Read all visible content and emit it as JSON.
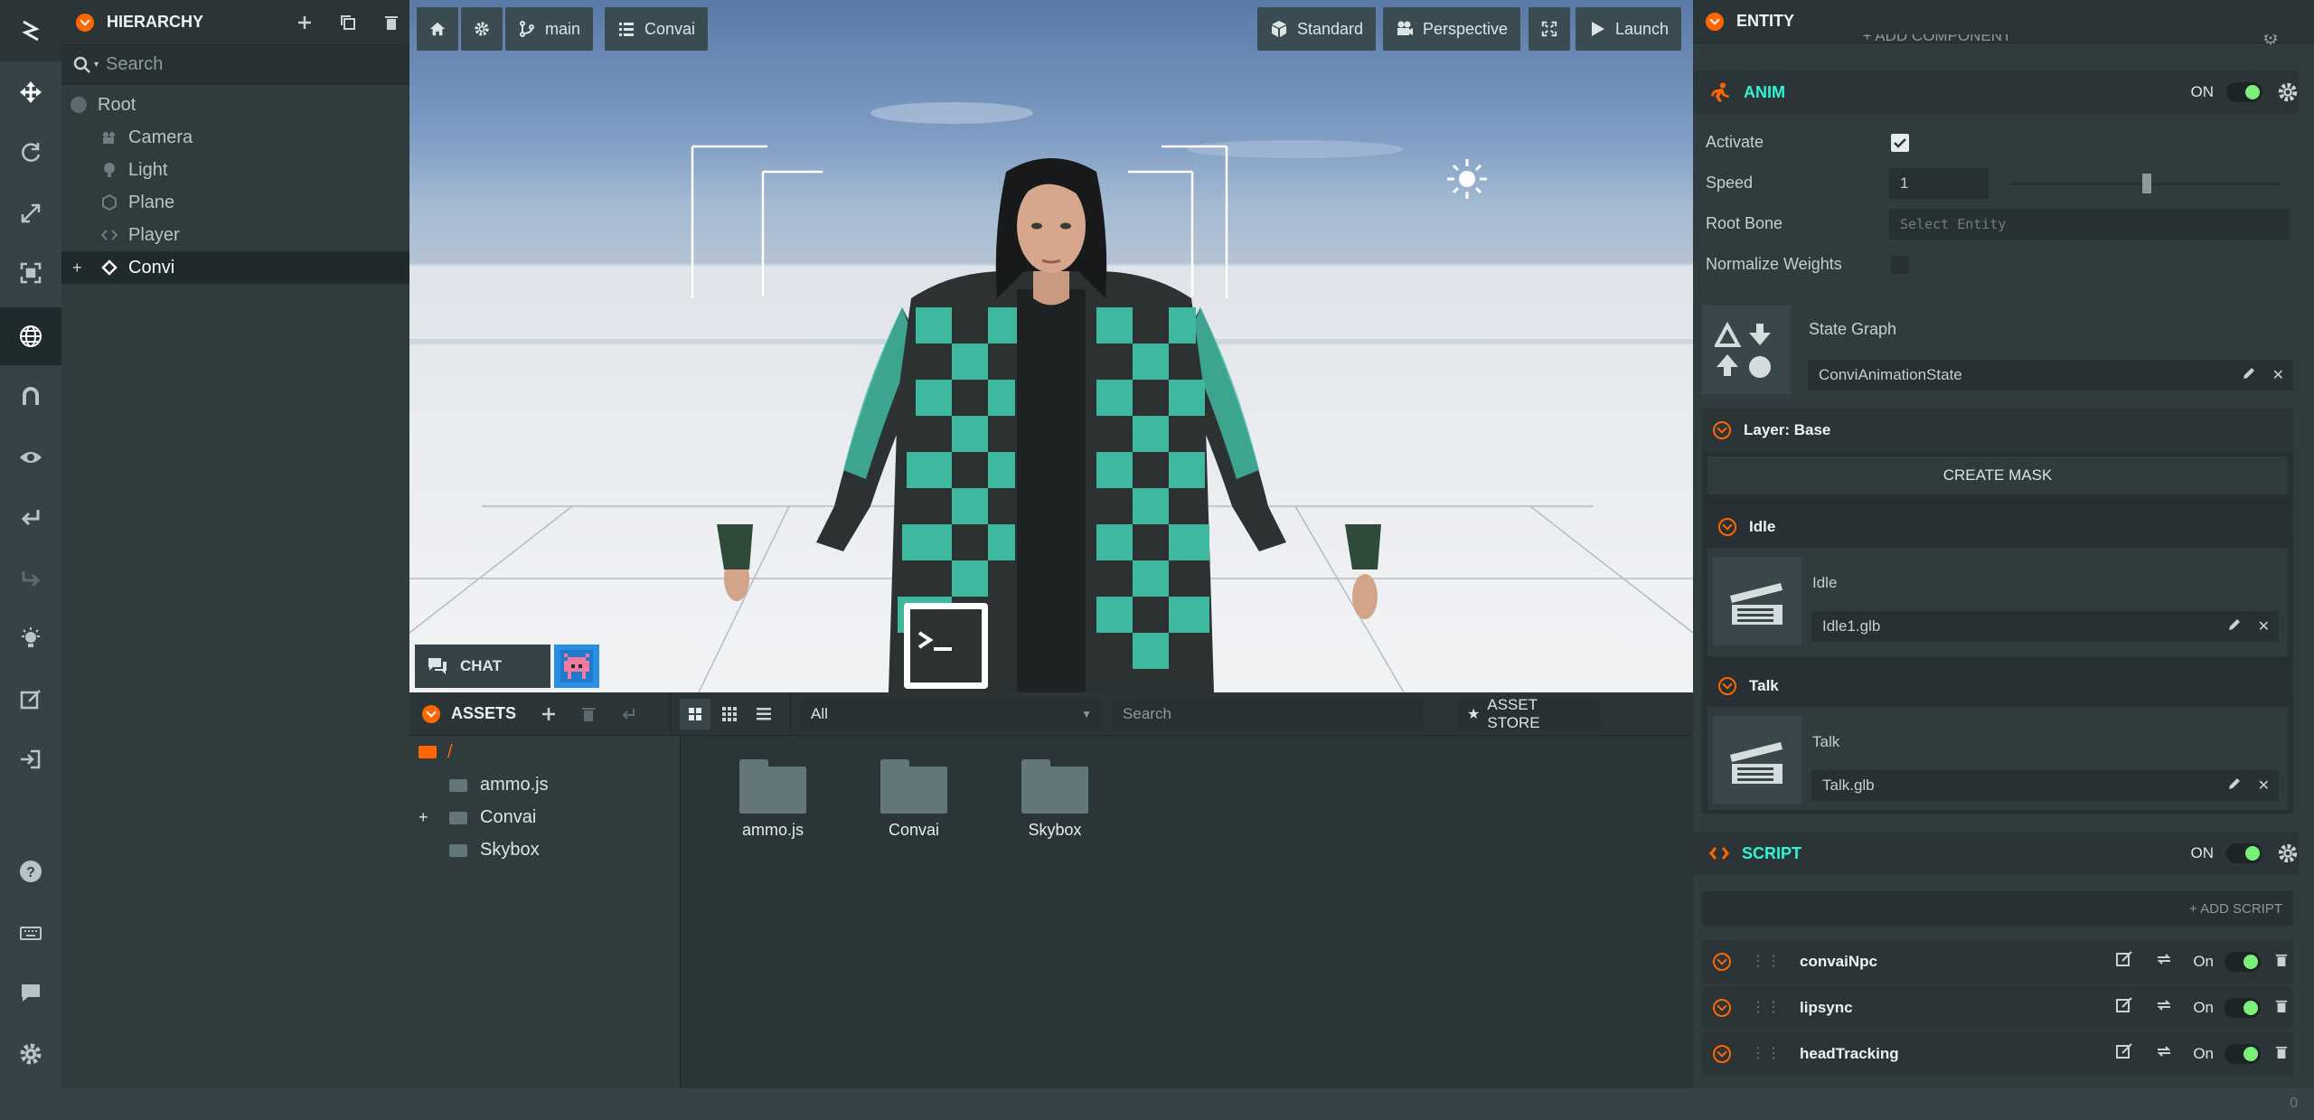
{
  "toolbar": {
    "tools": [
      "logo-icon",
      "move-icon",
      "rotate-icon",
      "scale-icon",
      "resize-icon",
      "world-icon",
      "magnet-icon",
      "eye-icon",
      "undo-icon",
      "redo-icon",
      "lightbulb-icon",
      "edit-icon",
      "publish-icon",
      "help-icon",
      "keyboard-icon",
      "chat-icon",
      "settings-icon"
    ]
  },
  "hierarchy": {
    "title": "HIERARCHY",
    "search_placeholder": "Search",
    "root": "Root",
    "items": [
      "Camera",
      "Light",
      "Plane",
      "Player",
      "Convi"
    ],
    "selected": "Convi"
  },
  "viewport": {
    "branch": "main",
    "project": "Convai",
    "render_mode": "Standard",
    "camera": "Perspective",
    "launch": "Launch",
    "chat_label": "CHAT"
  },
  "assets": {
    "title": "ASSETS",
    "filter": "All",
    "search_placeholder": "Search",
    "store": "ASSET STORE",
    "root_path": "/",
    "tree": [
      "ammo.js",
      "Convai",
      "Skybox"
    ],
    "folders": [
      "ammo.js",
      "Convai",
      "Skybox"
    ]
  },
  "inspector": {
    "title": "ENTITY",
    "add_component": "ADD COMPONENT",
    "anim": {
      "title": "ANIM",
      "on": "ON",
      "activate_label": "Activate",
      "speed_label": "Speed",
      "speed_value": "1",
      "speed_fraction": 0.49,
      "root_bone_label": "Root Bone",
      "root_bone_placeholder": "Select Entity",
      "normalize_label": "Normalize Weights",
      "state_graph_label": "State Graph",
      "state_graph_value": "ConviAnimationState",
      "layer_title": "Layer: Base",
      "create_mask": "CREATE MASK",
      "states": [
        {
          "title": "Idle",
          "label": "Idle",
          "file": "Idle1.glb"
        },
        {
          "title": "Talk",
          "label": "Talk",
          "file": "Talk.glb"
        }
      ]
    },
    "script": {
      "title": "SCRIPT",
      "on": "ON",
      "add_script": "+ ADD SCRIPT",
      "scripts": [
        {
          "name": "convaiNpc",
          "state": "On"
        },
        {
          "name": "lipsync",
          "state": "On"
        },
        {
          "name": "headTracking",
          "state": "On"
        }
      ]
    }
  },
  "status": {
    "count": "0"
  }
}
